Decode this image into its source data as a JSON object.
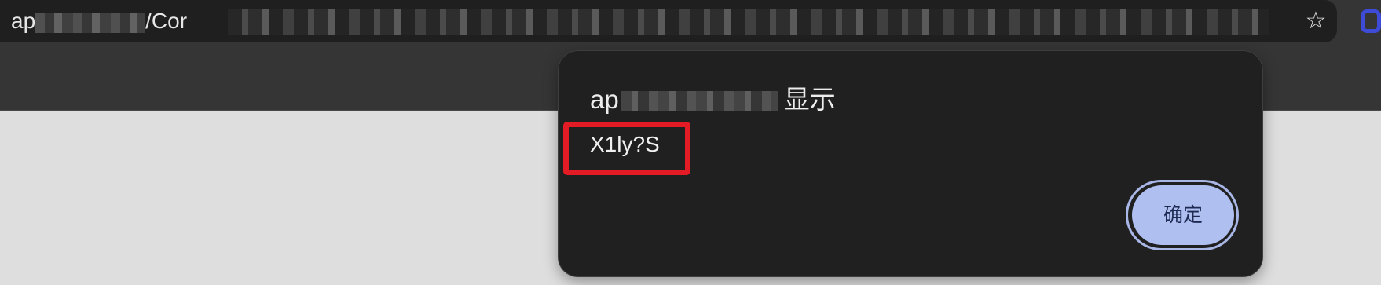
{
  "browser": {
    "url_visible_start": "ap",
    "url_visible_mid": "/Cor",
    "bookmark_icon": "star-icon",
    "extension_icon": "extension-icon"
  },
  "dialog": {
    "title_prefix": "ap",
    "title_suffix": "显示",
    "message": "X1ly?S",
    "ok_label": "确定",
    "accent_color": "#aebff0",
    "highlight_color": "#e21b24"
  }
}
